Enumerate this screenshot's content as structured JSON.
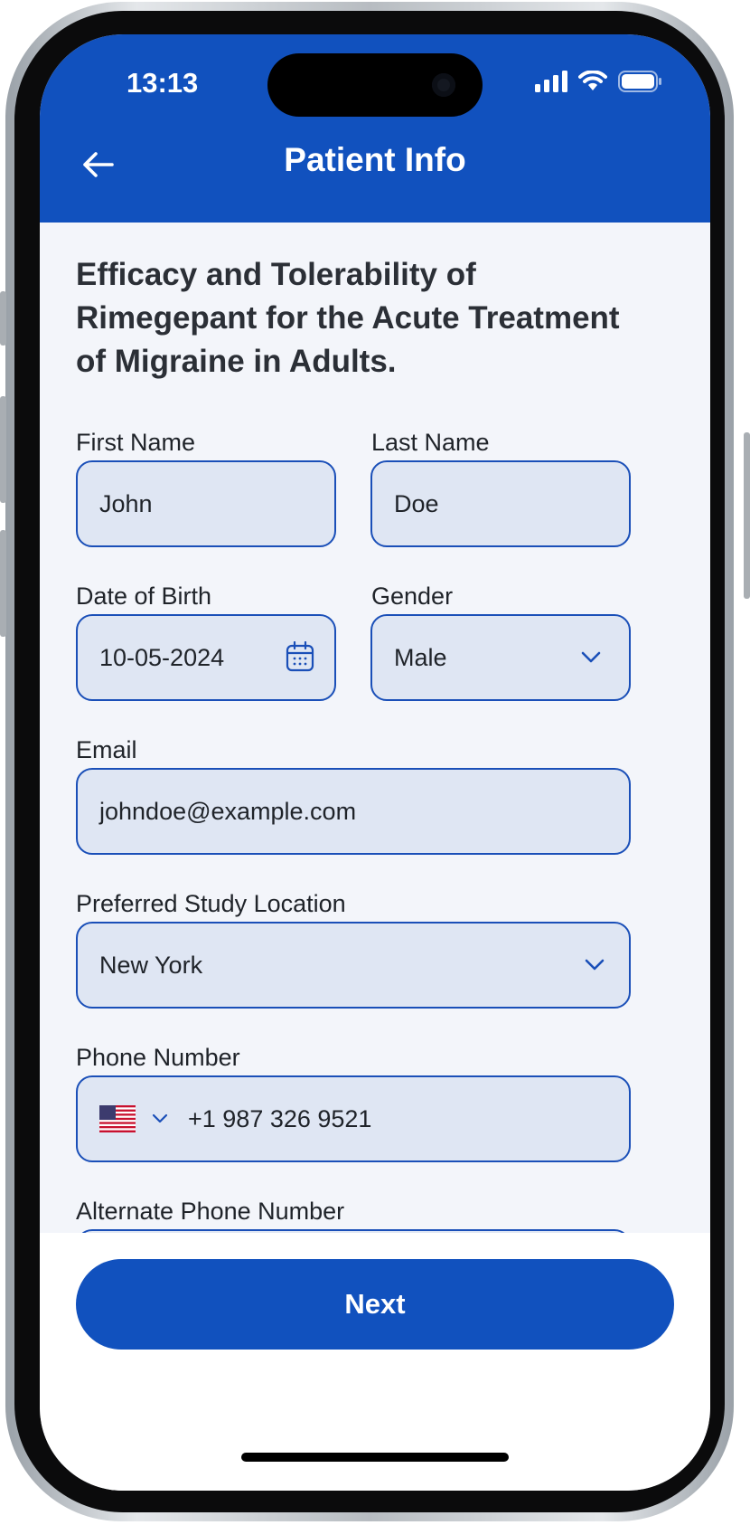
{
  "status_bar": {
    "time": "13:13"
  },
  "header": {
    "title": "Patient Info"
  },
  "study_title": "Efficacy and Tolerability of Rimegepant for the Acute Treatment of Migraine in Adults.",
  "form": {
    "first_name": {
      "label": "First Name",
      "value": "John"
    },
    "last_name": {
      "label": "Last Name",
      "value": "Doe"
    },
    "dob": {
      "label": "Date of Birth",
      "value": "10-05-2024"
    },
    "gender": {
      "label": "Gender",
      "value": "Male"
    },
    "email": {
      "label": "Email",
      "value": "johndoe@example.com"
    },
    "location": {
      "label": "Preferred Study Location",
      "value": "New York"
    },
    "phone": {
      "label": "Phone Number",
      "value": "+1 987 326 9521",
      "country": "US"
    },
    "alt_phone": {
      "label": "Alternate Phone Number",
      "value": ""
    }
  },
  "footer": {
    "next_label": "Next"
  },
  "colors": {
    "primary": "#1151be",
    "field_bg": "#dfe6f3",
    "field_border": "#1a4fb8",
    "page_bg": "#f3f5fa"
  },
  "icons": [
    "back-arrow-icon",
    "calendar-icon",
    "chevron-down-icon",
    "us-flag-icon",
    "signal-icon",
    "wifi-icon",
    "battery-icon"
  ]
}
